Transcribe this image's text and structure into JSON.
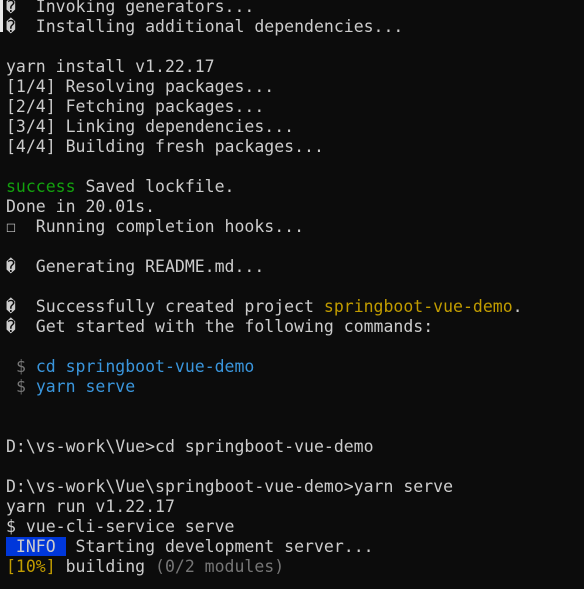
{
  "terminal": {
    "colors": {
      "background": "#0c0c0c",
      "foreground": "#cccccc",
      "success": "#13a10e",
      "highlight": "#c19c00",
      "command": "#3a96dd",
      "dim": "#767676",
      "info_bg": "#0037da"
    },
    "glyphs": {
      "unknown": "�",
      "box": "☐",
      "dollar": "$"
    },
    "lines": {
      "l0": "  Invoking generators...",
      "l1": "  Installing additional dependencies...",
      "yarn_install": "yarn install v1.22.17",
      "step1": "[1/4] Resolving packages...",
      "step2": "[2/4] Fetching packages...",
      "step3": "[3/4] Linking dependencies...",
      "step4": "[4/4] Building fresh packages...",
      "success_word": "success",
      "success_rest": " Saved lockfile.",
      "done": "Done in 20.01s.",
      "hooks": "  Running completion hooks...",
      "readme": "  Generating README.md...",
      "created_prefix": "  Successfully created project ",
      "project_name": "springboot-vue-demo",
      "created_suffix": ".",
      "get_started": "  Get started with the following commands:",
      "cmd1": "cd springboot-vue-demo",
      "cmd2": "yarn serve",
      "prompt1": "D:\\vs-work\\Vue>cd springboot-vue-demo",
      "prompt2": "D:\\vs-work\\Vue\\springboot-vue-demo>yarn serve",
      "yarn_run": "yarn run v1.22.17",
      "vue_cli": "$ vue-cli-service serve",
      "info_badge": " INFO ",
      "info_text": " Starting development server...",
      "progress_pct": "[10%]",
      "building": " building ",
      "modules": "(0/2 modules)"
    }
  }
}
